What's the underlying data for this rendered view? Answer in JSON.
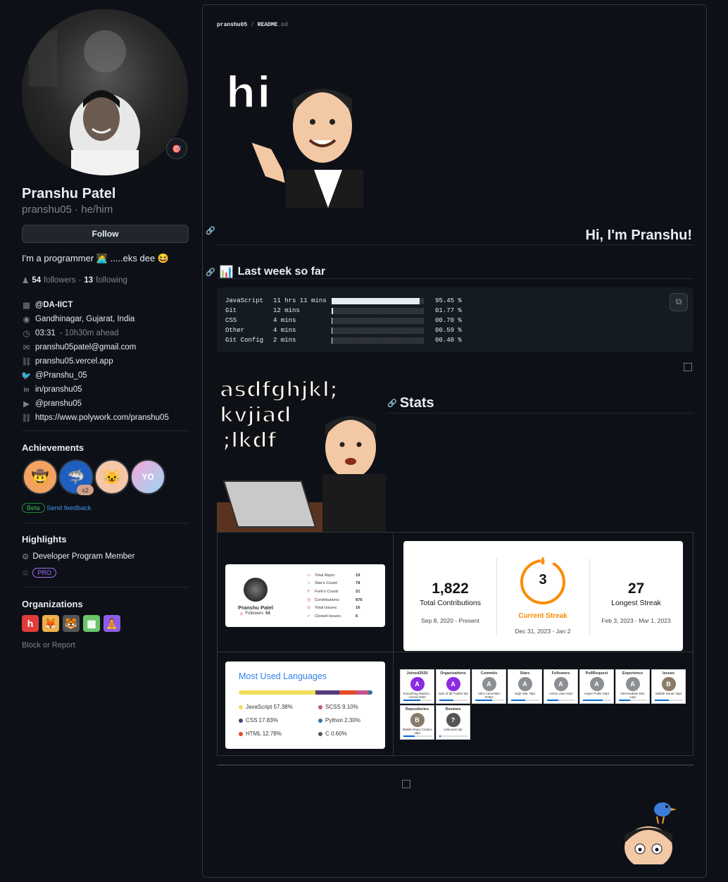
{
  "profile": {
    "name": "Pranshu Patel",
    "login": "pranshu05 · he/him",
    "follow_label": "Follow",
    "bio": "I'm a programmer 🧑‍💻 .....eks dee 😆",
    "followers_count": "54",
    "followers_label": "followers",
    "following_count": "13",
    "following_label": "following",
    "status_emoji": "🎯"
  },
  "vcard": [
    {
      "icon": "organization-icon",
      "text": "@DA-IICT",
      "bold": true
    },
    {
      "icon": "location-icon",
      "text": "Gandhinagar, Gujarat, India"
    },
    {
      "icon": "clock-icon",
      "text": "03:31",
      "extra": "- 10h30m ahead"
    },
    {
      "icon": "mail-icon",
      "text": "pranshu05patel@gmail.com"
    },
    {
      "icon": "link-icon",
      "text": "pranshu05.vercel.app"
    },
    {
      "icon": "twitter-icon",
      "text": "@Pranshu_05"
    },
    {
      "icon": "linkedin-icon",
      "text": "in/pranshu05"
    },
    {
      "icon": "youtube-icon",
      "text": "@pranshu05"
    },
    {
      "icon": "link-icon",
      "text": "https://www.polywork.com/pranshu05"
    }
  ],
  "achievements": {
    "title": "Achievements",
    "count_badge": "x2",
    "beta": "Beta",
    "feedback": "Send feedback"
  },
  "highlights": {
    "title": "Highlights",
    "items": [
      "Developer Program Member"
    ],
    "pro": "PRO"
  },
  "organizations": {
    "title": "Organizations",
    "block": "Block or Report"
  },
  "readme": {
    "crumb_user": "pranshu05",
    "crumb_file": "README",
    "crumb_ext": ".md",
    "hi_text": "hi",
    "intro_heading": "Hi, I'm Pranshu!",
    "week_heading": "Last week so far",
    "week_emoji": "📊",
    "stats_heading": "Stats",
    "sticker_text": [
      "asdfghjkl;",
      "kvjiad",
      ";lkdf"
    ]
  },
  "wakatime": [
    {
      "lang": "JavaScript",
      "time": "11 hrs 11 mins",
      "pct": "95.45 %",
      "fill": 0.9545
    },
    {
      "lang": "Git",
      "time": "12 mins",
      "pct": "01.77 %",
      "fill": 0.0177
    },
    {
      "lang": "CSS",
      "time": "4 mins",
      "pct": "00.70 %",
      "fill": 0.007
    },
    {
      "lang": "Other",
      "time": "4 mins",
      "pct": "00.59 %",
      "fill": 0.0059
    },
    {
      "lang": "Git Config",
      "time": "2 mins",
      "pct": "00.40 %",
      "fill": 0.004
    }
  ],
  "profile_card": {
    "name": "Pranshu Patel",
    "followers_label": "Followers",
    "followers": "54",
    "rows": [
      {
        "label": "Total Repo:",
        "value": "19"
      },
      {
        "label": "Star's Count:",
        "value": "78"
      },
      {
        "label": "Fork's Count:",
        "value": "21"
      },
      {
        "label": "Contributions:",
        "value": "876"
      },
      {
        "label": "Total Issues:",
        "value": "16"
      },
      {
        "label": "Closed Issues:",
        "value": "6"
      }
    ]
  },
  "streak": {
    "total": "1,822",
    "total_label": "Total Contributions",
    "total_range": "Sep 8, 2020 - Present",
    "current": "3",
    "current_label": "Current Streak",
    "current_range": "Dec 31, 2023 - Jan 2",
    "longest": "27",
    "longest_label": "Longest Streak",
    "longest_range": "Feb 3, 2023 - Mar 1, 2023",
    "accent": "#fb8c00"
  },
  "languages": {
    "title": "Most Used Languages",
    "items": [
      {
        "name": "JavaScript 57.38%",
        "color": "#f1e05a",
        "value": 57.38
      },
      {
        "name": "SCSS 9.10%",
        "color": "#c6538c",
        "value": 9.1
      },
      {
        "name": "CSS 17.83%",
        "color": "#563d7c",
        "value": 17.83
      },
      {
        "name": "Python 2.30%",
        "color": "#3572A5",
        "value": 2.3
      },
      {
        "name": "HTML 12.78%",
        "color": "#e34c26",
        "value": 12.78
      },
      {
        "name": "C 0.60%",
        "color": "#555555",
        "value": 0.6
      }
    ]
  },
  "trophies": [
    {
      "title": "Joined2020",
      "rank": "A",
      "desc": "Everything started... Joined 2020",
      "fill": 0.6,
      "color": "#8a2be2"
    },
    {
      "title": "Organizations",
      "rank": "A",
      "desc": "Jack of all Trades 5pt",
      "fill": 0.5,
      "color": "#8a2be2"
    },
    {
      "title": "Commits",
      "rank": "A",
      "desc": "Ultra Committer 876pt",
      "fill": 0.6,
      "color": "#8c9094"
    },
    {
      "title": "Stars",
      "rank": "A",
      "desc": "High Star 78pt",
      "fill": 0.5,
      "color": "#8c9094"
    },
    {
      "title": "Followers",
      "rank": "A",
      "desc": "Active User 54pt",
      "fill": 0.4,
      "color": "#8c9094"
    },
    {
      "title": "PullRequest",
      "rank": "A",
      "desc": "Hyper Puller 94pt",
      "fill": 0.7,
      "color": "#8c9094"
    },
    {
      "title": "Experience",
      "rank": "A",
      "desc": "Intermediate Dev 12pt",
      "fill": 0.4,
      "color": "#8c9094"
    },
    {
      "title": "Issues",
      "rank": "B",
      "desc": "Middle Issuer 16pt",
      "fill": 0.5,
      "color": "#8a7b6a"
    },
    {
      "title": "Repositories",
      "rank": "B",
      "desc": "Middle Repo Creator 19pt",
      "fill": 0.4,
      "color": "#8a7b6a"
    },
    {
      "title": "Reviews",
      "rank": "?",
      "desc": "Unknown 0pt",
      "fill": 0.05,
      "color": "#555"
    }
  ]
}
